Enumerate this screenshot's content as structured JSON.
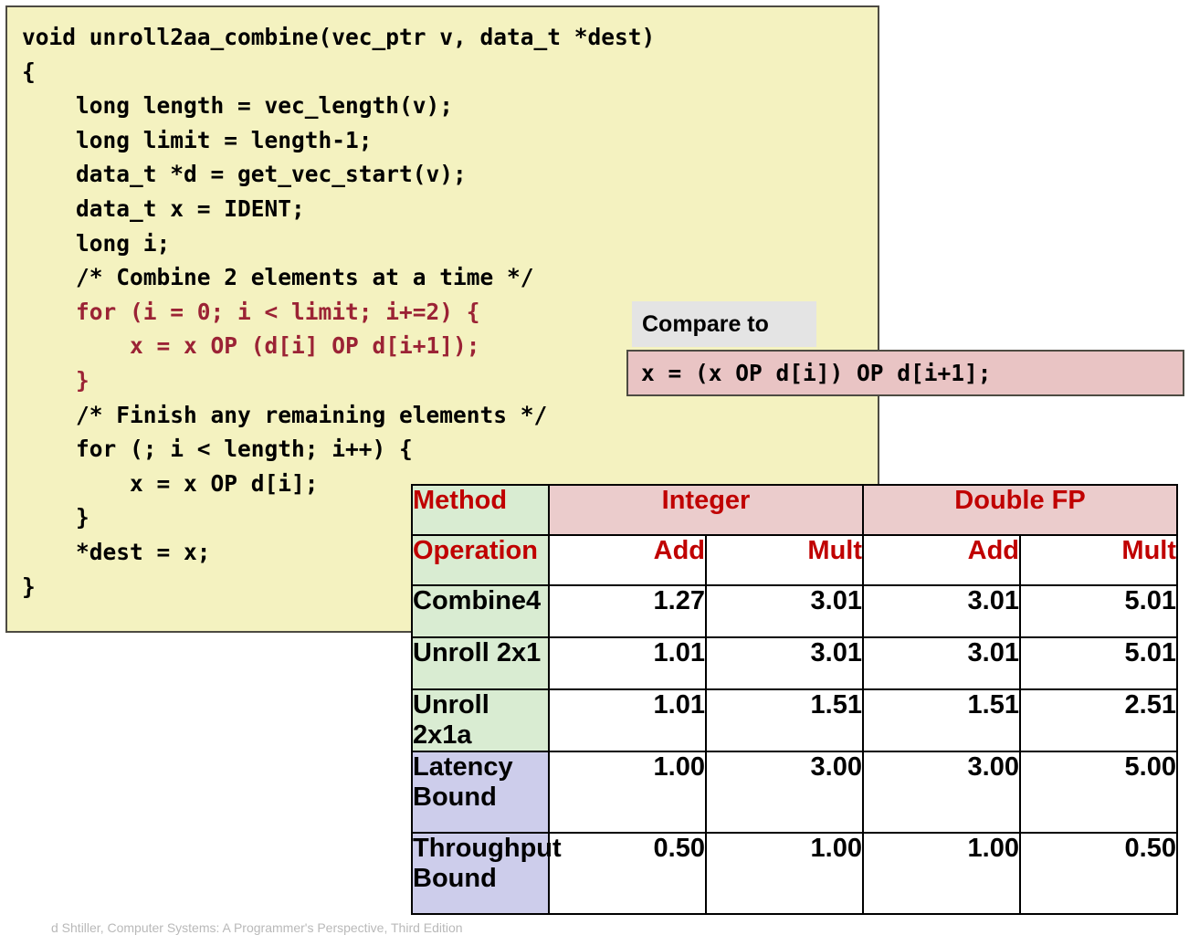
{
  "code_panel": {
    "name": "unroll2aa_combine-listing",
    "lines": [
      {
        "text": "void unroll2aa_combine(vec_ptr v, data_t *dest)",
        "highlight": false
      },
      {
        "text": "{",
        "highlight": false
      },
      {
        "text": "    long length = vec_length(v);",
        "highlight": false
      },
      {
        "text": "    long limit = length-1;",
        "highlight": false
      },
      {
        "text": "    data_t *d = get_vec_start(v);",
        "highlight": false
      },
      {
        "text": "    data_t x = IDENT;",
        "highlight": false
      },
      {
        "text": "    long i;",
        "highlight": false
      },
      {
        "text": "    /* Combine 2 elements at a time */",
        "highlight": false
      },
      {
        "text": "    for (i = 0; i < limit; i+=2) {",
        "highlight": true
      },
      {
        "text": "        x = x OP (d[i] OP d[i+1]);",
        "highlight": true
      },
      {
        "text": "    }",
        "highlight": true
      },
      {
        "text": "    /* Finish any remaining elements */",
        "highlight": false
      },
      {
        "text": "    for (; i < length; i++) {",
        "highlight": false
      },
      {
        "text": "        x = x OP d[i];",
        "highlight": false
      },
      {
        "text": "    }",
        "highlight": false
      },
      {
        "text": "    *dest = x;",
        "highlight": false
      },
      {
        "text": "}",
        "highlight": false
      }
    ]
  },
  "callout": {
    "label": "Compare to",
    "expression": "x = (x OP d[i]) OP d[i+1];"
  },
  "table": {
    "header_method": "Method",
    "header_operation": "Operation",
    "groups": [
      "Integer",
      "Double FP"
    ],
    "operations": [
      "Add",
      "Mult",
      "Add",
      "Mult"
    ],
    "rows": [
      {
        "label": "Combine4",
        "label_style": "green",
        "values": [
          "1.27",
          "3.01",
          "3.01",
          "5.01"
        ]
      },
      {
        "label": "Unroll 2x1",
        "label_style": "green",
        "values": [
          "1.01",
          "3.01",
          "3.01",
          "5.01"
        ]
      },
      {
        "label": "Unroll 2x1a",
        "label_style": "green",
        "values": [
          "1.01",
          "1.51",
          "1.51",
          "2.51"
        ]
      },
      {
        "label": "Latency\nBound",
        "label_style": "purple",
        "values": [
          "1.00",
          "3.00",
          "3.00",
          "5.00"
        ]
      },
      {
        "label": "Throughput\nBound",
        "label_style": "purple",
        "values": [
          "0.50",
          "1.00",
          "1.00",
          "0.50"
        ]
      }
    ]
  },
  "footer": {
    "note": "d Shtiller, Computer Systems: A Programmer's Perspective, Third Edition"
  },
  "colors": {
    "code_bg": "#f4f2c0",
    "code_border": "#4d4b42",
    "code_highlight": "#9b2335",
    "callout_label_bg": "#e4e4e4",
    "callout_expr_bg": "#e9c4c4",
    "table_header_green": "#d9ecd2",
    "table_header_pink": "#ebcccc",
    "table_label_purple": "#cdcdeb",
    "table_header_text": "#c00000"
  }
}
